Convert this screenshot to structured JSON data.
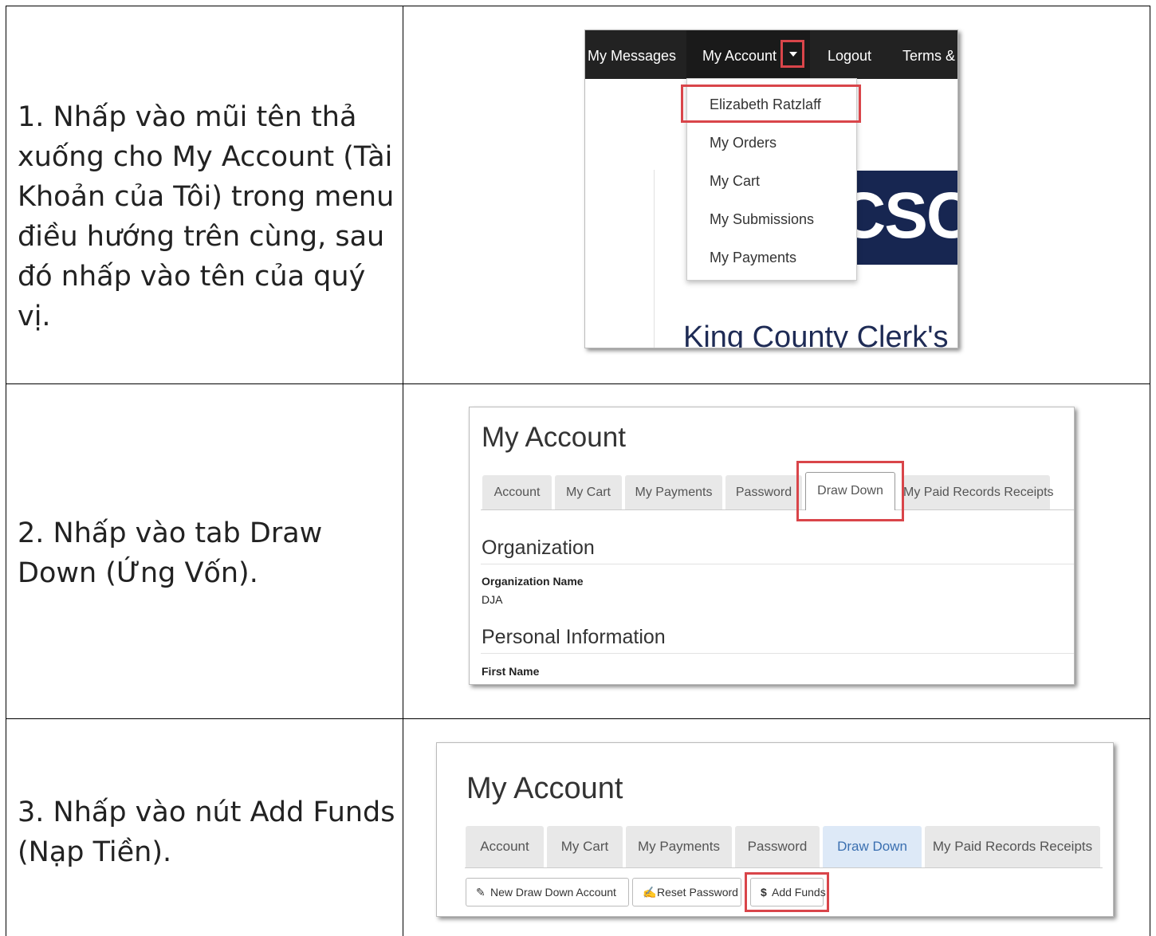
{
  "steps": [
    {
      "text": "1.  Nhấp vào mũi tên thả xuống cho My Account (Tài Khoản của Tôi) trong menu điều hướng trên cùng, sau đó nhấp vào tên của quý vị."
    },
    {
      "text": "2.  Nhấp vào tab Draw Down (Ứng Vốn)."
    },
    {
      "text": "3.  Nhấp vào nút Add Funds (Nạp Tiền)."
    }
  ],
  "shot1": {
    "nav": {
      "my_messages": "My Messages",
      "my_account": "My Account",
      "logout": "Logout",
      "terms": "Terms & "
    },
    "dropdown": [
      "Elizabeth Ratzlaff",
      "My Orders",
      "My Cart",
      "My Submissions",
      "My Payments"
    ],
    "banner_text": "CSCF",
    "page_title": "King County Clerk's"
  },
  "shot2": {
    "title": "My Account",
    "tabs": [
      "Account",
      "My Cart",
      "My Payments",
      "Password",
      "Draw Down",
      "My Paid Records Receipts"
    ],
    "section1": "Organization",
    "org_label": "Organization Name",
    "org_value": "DJA",
    "section2": "Personal Information",
    "first_name_label": "First Name"
  },
  "shot3": {
    "title": "My Account",
    "tabs": [
      "Account",
      "My Cart",
      "My Payments",
      "Password",
      "Draw Down",
      "My Paid Records Receipts"
    ],
    "buttons": {
      "new_draw_down": "New Draw Down Account",
      "reset_password": "Reset Password",
      "add_funds": "Add Funds"
    }
  },
  "colors": {
    "highlight": "#d9454a",
    "nav_bg": "#222222",
    "banner_bg": "#172651",
    "active_tab_bg": "#dde9f7"
  },
  "icons": [
    "caret-down-icon",
    "pencil-icon",
    "edit-icon",
    "dollar-icon"
  ]
}
